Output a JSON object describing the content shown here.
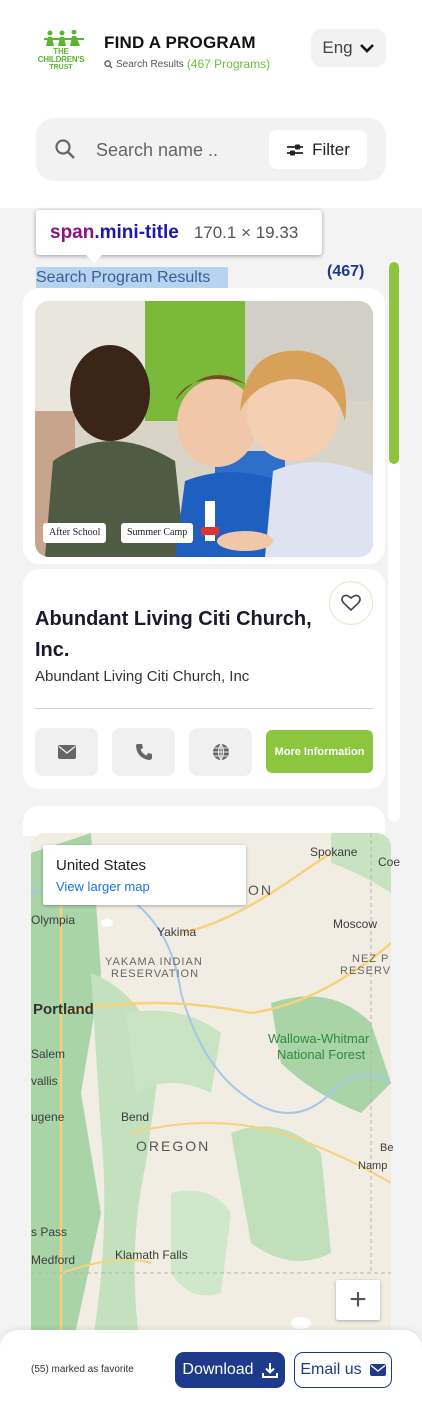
{
  "header": {
    "logo_line1": "THE",
    "logo_line2": "CHILDREN'S",
    "logo_line3": "TRUST",
    "title": "FIND A PROGRAM",
    "subtitle": "Search Results",
    "program_count": "(467 Programs)",
    "language": "Eng"
  },
  "search": {
    "placeholder": "Search name ..",
    "filter_label": "Filter"
  },
  "devtools_tooltip": {
    "tag": "span",
    "class": ".mini-title",
    "dimensions": "170.1 × 19.33"
  },
  "results": {
    "title": "Search Program Results",
    "count": "(467)"
  },
  "card": {
    "tags": [
      "After School",
      "Summer Camp"
    ],
    "name": "Abundant Living Citi Church, Inc.",
    "organization": "Abundant Living Citi Church, Inc",
    "more_label": "More Information"
  },
  "map": {
    "place_title": "United States",
    "larger_map_link": "View larger map",
    "labels": {
      "spokane": "Spokane",
      "coe": "Coe",
      "on": "ON",
      "olympia": "Olympia",
      "yakima": "Yakima",
      "moscow": "Moscow",
      "yakama1": "YAKAMA INDIAN",
      "yakama2": "RESERVATION",
      "nez1": "NEZ P",
      "nez2": "RESERV",
      "portland": "Portland",
      "wallowa1": "Wallowa-Whitmar",
      "wallowa2": "National Forest",
      "salem": "Salem",
      "vallis": "vallis",
      "ugene": "ugene",
      "bend": "Bend",
      "oregon": "OREGON",
      "be": "Be",
      "namp": "Namp",
      "spass": "s Pass",
      "medford": "Medford",
      "klamath": "Klamath Falls"
    },
    "zoom_in": "+"
  },
  "footer": {
    "favorites": "(55) marked as favorite",
    "download": "Download",
    "email": "Email us"
  },
  "colors": {
    "brand_green": "#8cc63f",
    "brand_navy": "#1e3a8a"
  }
}
